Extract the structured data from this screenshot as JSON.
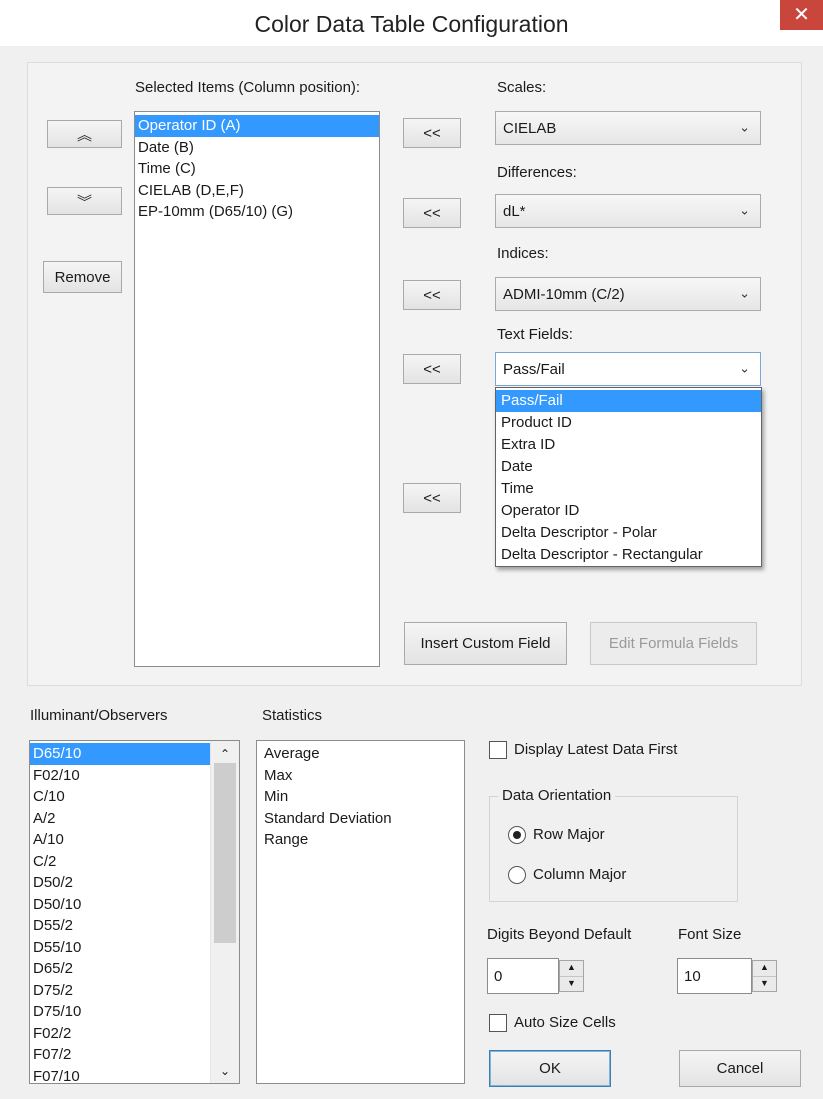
{
  "window": {
    "title": "Color Data Table Configuration",
    "close_glyph": "✕"
  },
  "selected_items": {
    "label": "Selected Items (Column position):",
    "items": [
      "Operator ID (A)",
      "Date (B)",
      "Time (C)",
      "CIELAB (D,E,F)",
      "EP-10mm (D65/10) (G)"
    ],
    "move_up_glyph": "︽",
    "move_down_glyph": "︾",
    "remove_label": "Remove"
  },
  "add_glyph": "<<",
  "scales": {
    "label": "Scales:",
    "value": "CIELAB"
  },
  "differences": {
    "label": "Differences:",
    "value": "dL*"
  },
  "indices": {
    "label": "Indices:",
    "value": "ADMI-10mm (C/2)"
  },
  "text_fields": {
    "label": "Text Fields:",
    "value": "Pass/Fail",
    "options": [
      "Pass/Fail",
      "Product ID",
      "Extra ID",
      "Date",
      "Time",
      "Operator ID",
      "Delta Descriptor - Polar",
      "Delta Descriptor - Rectangular"
    ]
  },
  "insert_custom_field_label": "Insert Custom Field",
  "edit_formula_fields_label": "Edit Formula Fields",
  "illuminant": {
    "label": "Illuminant/Observers",
    "items": [
      "D65/10",
      "F02/10",
      "C/10",
      "A/2",
      "A/10",
      "C/2",
      "D50/2",
      "D50/10",
      "D55/2",
      "D55/10",
      "D65/2",
      "D75/2",
      "D75/10",
      "F02/2",
      "F07/2",
      "F07/10"
    ]
  },
  "statistics": {
    "label": "Statistics",
    "items": [
      "Average",
      "Max",
      "Min",
      "Standard Deviation",
      "Range"
    ]
  },
  "display_latest_first": {
    "label": "Display Latest Data First",
    "checked": false
  },
  "data_orientation": {
    "label": "Data Orientation",
    "row_major": "Row Major",
    "column_major": "Column Major",
    "selected": "Row Major"
  },
  "digits_beyond_default": {
    "label": "Digits Beyond Default",
    "value": "0"
  },
  "font_size": {
    "label": "Font Size",
    "value": "10"
  },
  "auto_size_cells": {
    "label": "Auto Size Cells",
    "checked": false
  },
  "ok_label": "OK",
  "cancel_label": "Cancel",
  "colors": {
    "selection": "#3399ff",
    "close": "#c9463d"
  }
}
